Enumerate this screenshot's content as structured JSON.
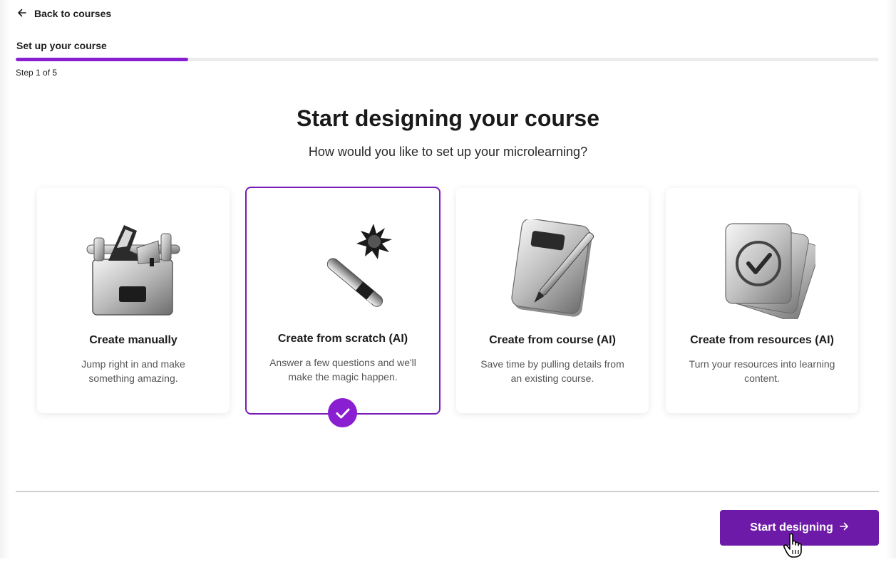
{
  "nav": {
    "back_label": "Back to courses",
    "back_icon": "arrow-left-icon"
  },
  "stepper": {
    "title": "Set up your course",
    "step_text": "Step 1 of 5",
    "progress": 0.2,
    "accent": "#8a1fd1"
  },
  "heading": "Start designing your course",
  "subheading": "How would you like to set up your microlearning?",
  "options": [
    {
      "title": "Create manually",
      "desc": "Jump right in and make something amazing.",
      "icon": "toolbox-icon",
      "selected": false
    },
    {
      "title": "Create from scratch (AI)",
      "desc": "Answer a few questions and we'll make the magic happen.",
      "icon": "magic-wand-icon",
      "selected": true
    },
    {
      "title": "Create from course (AI)",
      "desc": "Save time by pulling details from an existing course.",
      "icon": "notebook-pencil-icon",
      "selected": false
    },
    {
      "title": "Create from resources (AI)",
      "desc": "Turn your resources into learning content.",
      "icon": "stacked-cards-check-icon",
      "selected": false
    }
  ],
  "footer": {
    "primary_label": "Start designing",
    "primary_icon": "arrow-right-icon",
    "primary_color": "#6e1aa8"
  }
}
